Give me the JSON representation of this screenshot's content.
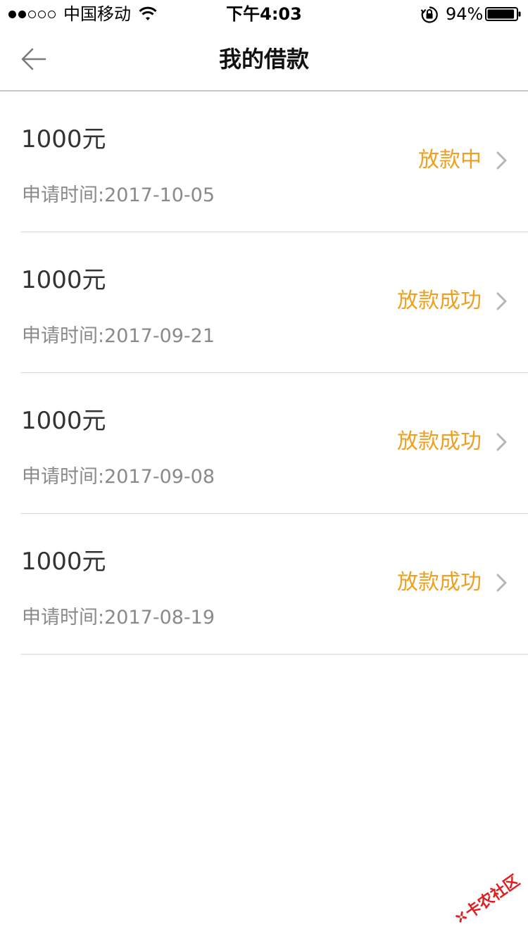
{
  "status_bar": {
    "carrier": "中国移动",
    "time": "下午4:03",
    "battery": "94%",
    "battery_level": 0.94,
    "icons": [
      "signal-dots",
      "wifi-icon",
      "rotation-lock-icon",
      "battery-icon"
    ]
  },
  "nav": {
    "title": "我的借款",
    "back_icon": "arrow-left-icon"
  },
  "loans": [
    {
      "amount": "1000元",
      "date_label": "申请时间:",
      "date": "2017-10-05",
      "status": "放款中"
    },
    {
      "amount": "1000元",
      "date_label": "申请时间:",
      "date": "2017-09-21",
      "status": "放款成功"
    },
    {
      "amount": "1000元",
      "date_label": "申请时间:",
      "date": "2017-09-08",
      "status": "放款成功"
    },
    {
      "amount": "1000元",
      "date_label": "申请时间:",
      "date": "2017-08-19",
      "status": "放款成功"
    }
  ],
  "watermark": {
    "text": "卡农社区"
  },
  "colors": {
    "status_accent": "#f0a020",
    "divider": "#d6d6d6",
    "secondary_text": "#8a8a8a"
  }
}
